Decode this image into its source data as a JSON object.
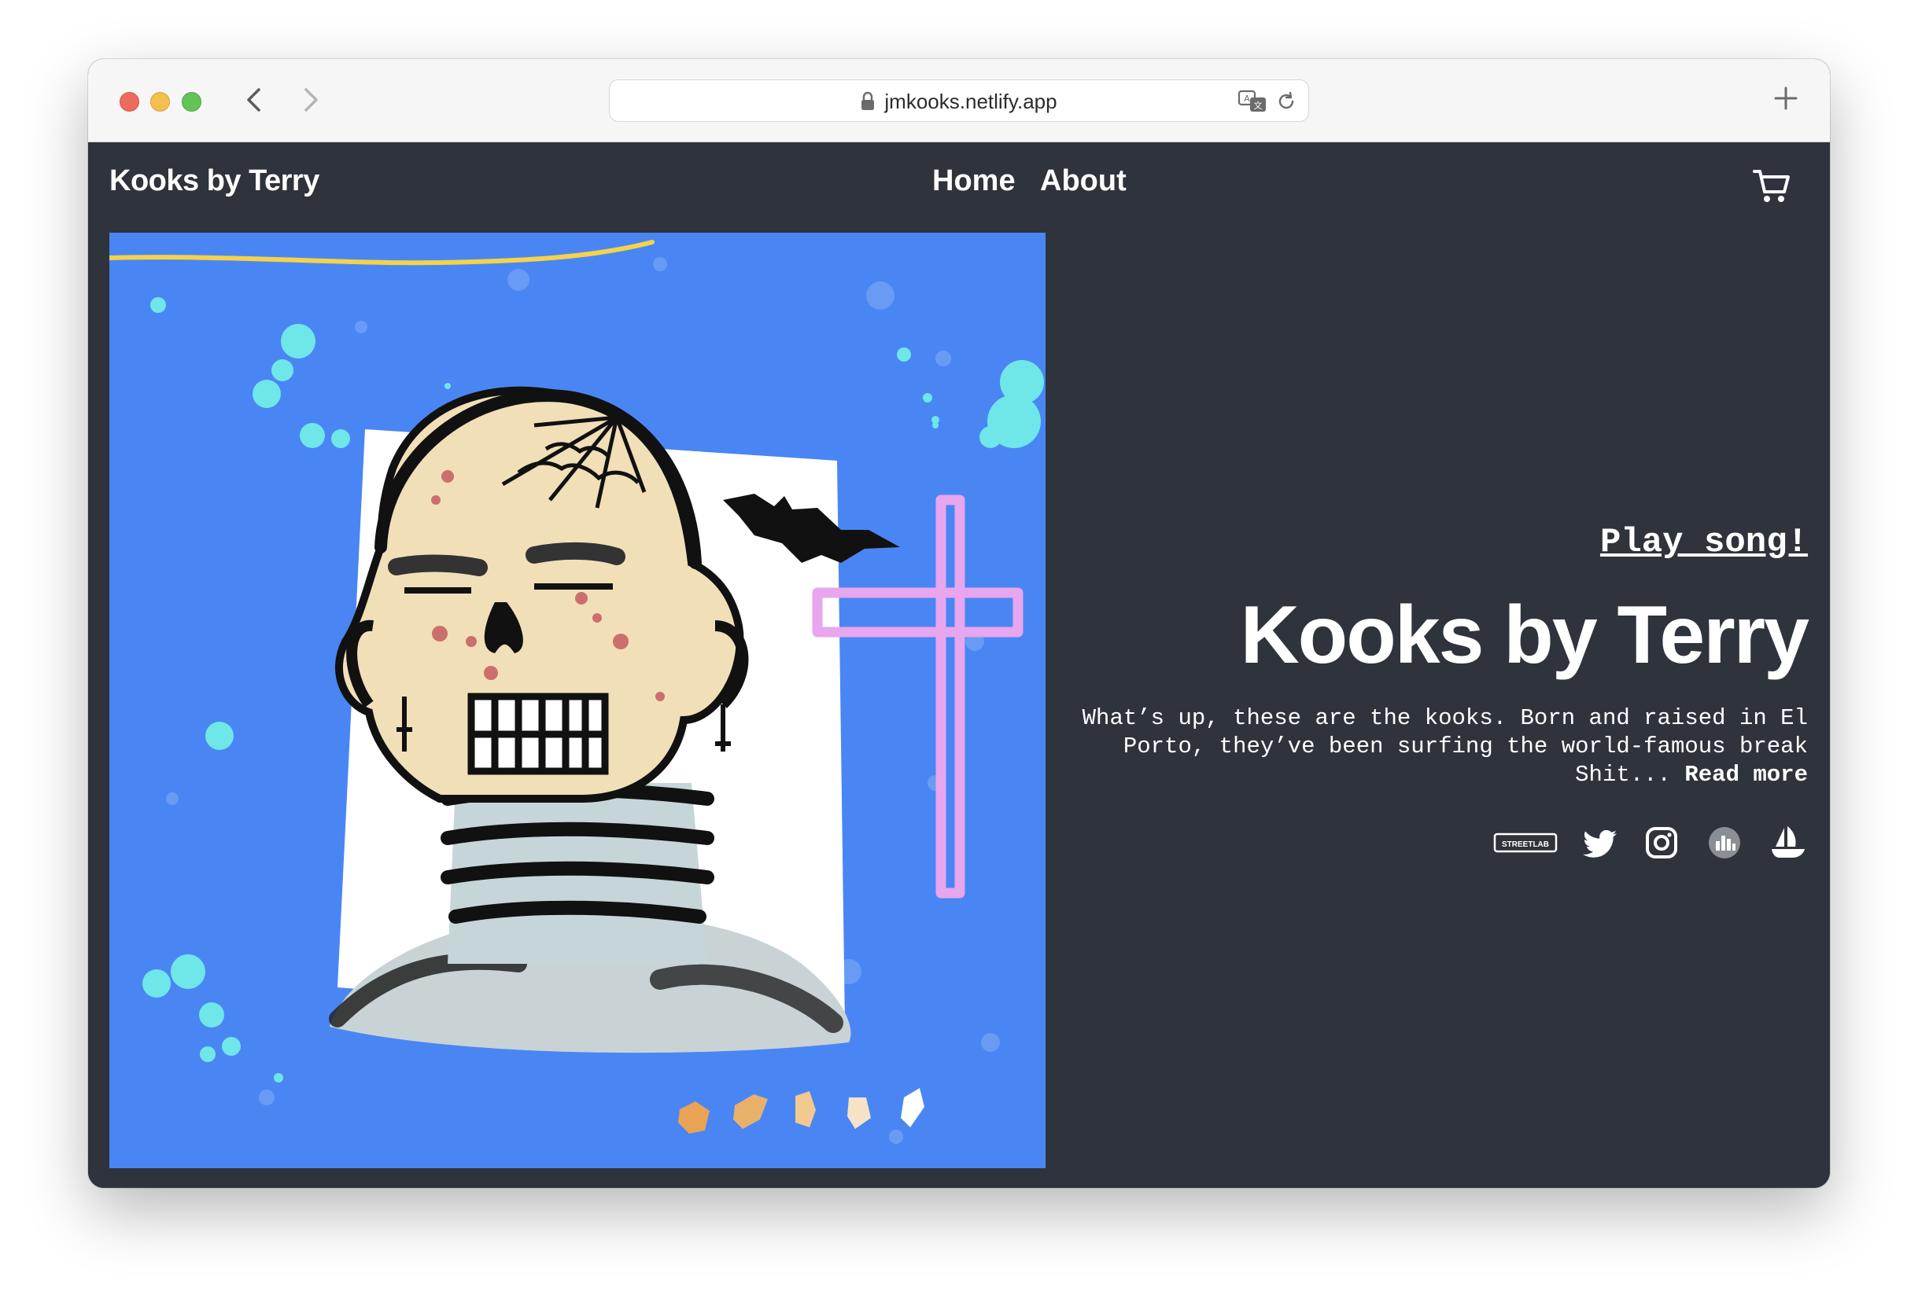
{
  "browser": {
    "url": "jmkooks.netlify.app"
  },
  "site": {
    "brand": "Kooks by Terry",
    "nav": {
      "home": "Home",
      "about": "About"
    },
    "hero": {
      "play_label": "Play song!",
      "title": "Kooks by Terry",
      "description": "What’s up, these are the kooks. Born and raised in El Porto, they’ve been surfing the world-famous break Shit...",
      "read_more": "Read more"
    },
    "social": {
      "streetlab_label": "STREETLAB",
      "icons": [
        "streetlab-icon",
        "twitter-icon",
        "instagram-icon",
        "rarible-icon",
        "opensea-icon"
      ]
    }
  },
  "colors": {
    "page_bg": "#2e333c",
    "art_bg": "#4a86f3",
    "text": "#ffffff"
  }
}
